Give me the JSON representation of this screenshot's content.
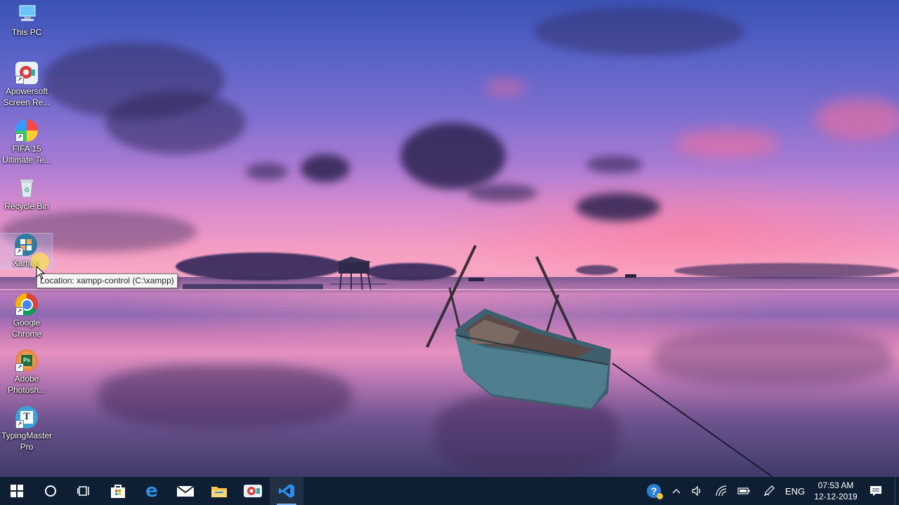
{
  "desktop_icons": [
    {
      "id": "this-pc",
      "label": "This PC"
    },
    {
      "id": "apowersoft",
      "label": "Apowersoft Screen Re..."
    },
    {
      "id": "fifa",
      "label": "FIFA 15 Ultimate Te..."
    },
    {
      "id": "recycle-bin",
      "label": "Recycle Bin"
    },
    {
      "id": "xampp",
      "label": "Xampp"
    },
    {
      "id": "chrome",
      "label": "Google Chrome"
    },
    {
      "id": "photoshop",
      "label": "Adobe Photosh..."
    },
    {
      "id": "typingmaster",
      "label": "TypingMaster Pro"
    }
  ],
  "tooltip": {
    "text": "Location: xampp-control (C:\\xampp)"
  },
  "taskbar": {
    "pinned": [
      {
        "name": "start-button",
        "icon": "windows-logo-icon"
      },
      {
        "name": "cortana-button",
        "icon": "search-circle-icon"
      },
      {
        "name": "task-view-button",
        "icon": "task-view-icon"
      },
      {
        "name": "store-button",
        "icon": "store-bag-icon"
      },
      {
        "name": "edge-button",
        "icon": "edge-icon"
      },
      {
        "name": "mail-button",
        "icon": "mail-icon"
      },
      {
        "name": "file-explorer-button",
        "icon": "folder-icon"
      },
      {
        "name": "apowersoft-button",
        "icon": "recorder-icon"
      },
      {
        "name": "vscode-button",
        "icon": "vscode-icon"
      }
    ],
    "tray": {
      "language": "ENG",
      "time": "07:53 AM",
      "date": "12-12-2019"
    }
  },
  "colors": {
    "taskbar": "#0f1f33",
    "active_indicator": "#7ab3f5",
    "tooltip_bg": "#f7f7f7"
  }
}
